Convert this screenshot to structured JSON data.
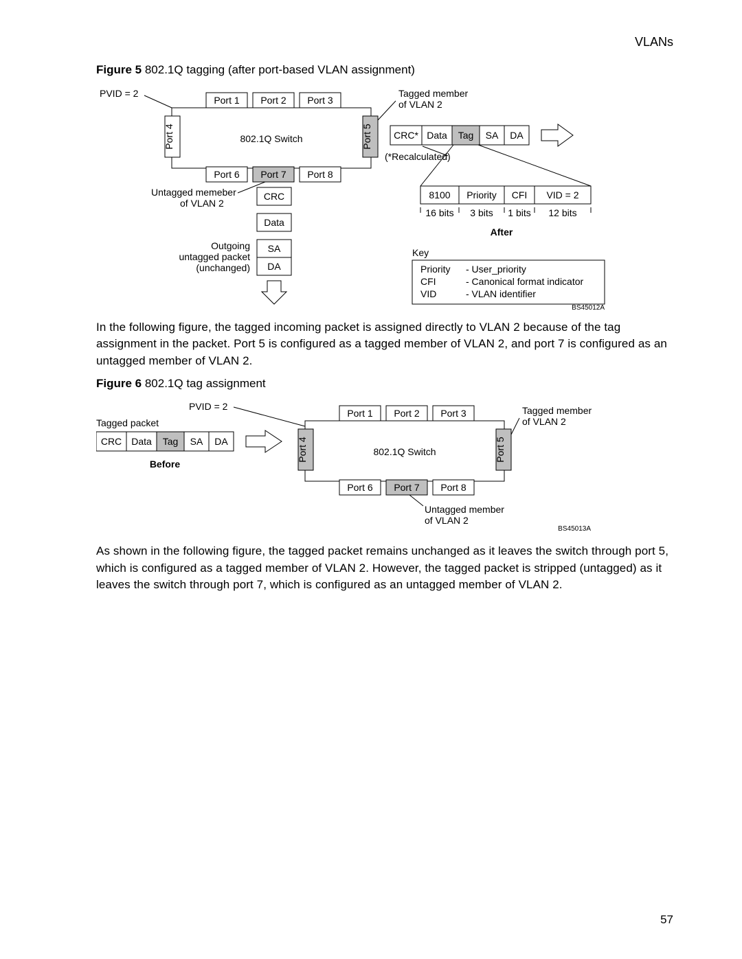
{
  "header": {
    "right": "VLANs"
  },
  "page_number": "57",
  "fig5": {
    "caption_label": "Figure 5",
    "caption_text": " 802.1Q tagging (after port-based VLAN assignment)",
    "pvid": "PVID = 2",
    "switch_label": "802.1Q Switch",
    "ports": [
      "Port 1",
      "Port 2",
      "Port 3",
      "Port 4",
      "Port 5",
      "Port 6",
      "Port 7",
      "Port 8"
    ],
    "tagged_member": "Tagged member",
    "of_vlan2": "of VLAN 2",
    "untagged_member": "Untagged memeber",
    "outgoing1": "Outgoing",
    "outgoing2": "untagged packet",
    "outgoing3": "(unchanged)",
    "packet_fields": [
      "CRC",
      "Data",
      "SA",
      "DA"
    ],
    "tagged_packet_fields": [
      "CRC*",
      "Data",
      "Tag",
      "SA",
      "DA"
    ],
    "recalc": "(*Recalculated)",
    "tag_fields": [
      "8100",
      "Priority",
      "CFI",
      "VID = 2"
    ],
    "tag_bits": [
      "16 bits",
      "3 bits",
      "1 bits",
      "12 bits"
    ],
    "after": "After",
    "key_title": "Key",
    "key_rows": [
      [
        "Priority",
        "- User_priority"
      ],
      [
        "CFI",
        "- Canonical format indicator"
      ],
      [
        "VID",
        "- VLAN identifier"
      ]
    ],
    "refcode": "BS45012A"
  },
  "para1": "In the following figure, the tagged incoming packet is assigned directly to VLAN 2 because of the tag assignment in the packet. Port 5 is configured as a tagged member of VLAN 2, and port 7 is configured as an untagged member of VLAN 2.",
  "fig6": {
    "caption_label": "Figure 6",
    "caption_text": " 802.1Q tag assignment",
    "pvid": "PVID = 2",
    "switch_label": "802.1Q Switch",
    "tagged_packet": "Tagged packet",
    "ports": [
      "Port 1",
      "Port 2",
      "Port 3",
      "Port 4",
      "Port 5",
      "Port 6",
      "Port 7",
      "Port 8"
    ],
    "packet_fields": [
      "CRC",
      "Data",
      "Tag",
      "SA",
      "DA"
    ],
    "before": "Before",
    "tagged_member": "Tagged member",
    "of_vlan2": "of VLAN 2",
    "untagged_member": "Untagged member",
    "refcode": "BS45013A"
  },
  "para2": "As shown in the following figure, the tagged packet remains unchanged as it leaves the switch through port 5, which is configured as a tagged member of VLAN 2. However, the tagged packet is stripped (untagged) as it leaves the switch through port 7, which is configured as an untagged member of VLAN 2."
}
